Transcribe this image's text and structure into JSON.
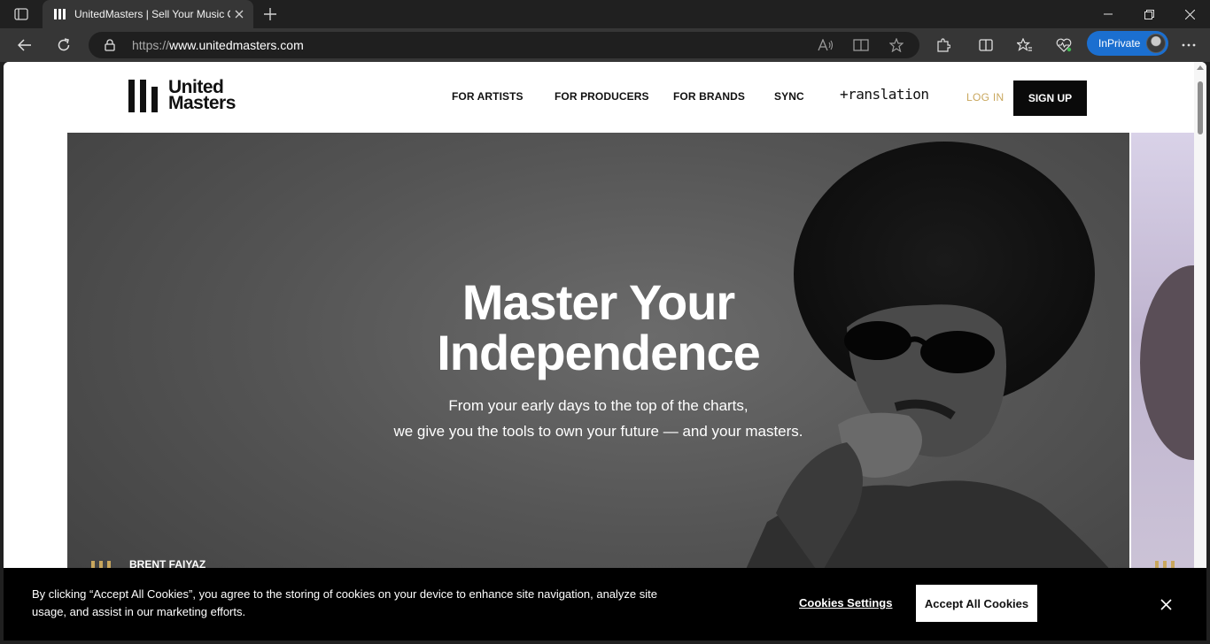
{
  "browser": {
    "tab": {
      "title": "UnitedMasters | Sell Your Music Online"
    },
    "address": {
      "protocol": "https://",
      "host": "www.unitedmasters.com"
    },
    "inprivate_label": "InPrivate"
  },
  "site": {
    "logo": {
      "line1": "United",
      "line2": "Masters"
    },
    "nav": [
      {
        "label": "FOR ARTISTS"
      },
      {
        "label": "FOR PRODUCERS"
      },
      {
        "label": "FOR BRANDS"
      },
      {
        "label": "SYNC"
      }
    ],
    "nav_translation": "+ranslation",
    "login_label": "LOG IN",
    "signup_label": "SIGN UP"
  },
  "hero": {
    "title_line1": "Master Your",
    "title_line2": "Independence",
    "subtitle_line1": "From your early days to the top of the charts,",
    "subtitle_line2": "we give you the tools to own your future — and your masters.",
    "caption": "BRENT FAIYAZ"
  },
  "cookie": {
    "text": "By clicking “Accept All Cookies”, you agree to the storing of cookies on your device to enhance site navigation, analyze site usage, and assist in our marketing efforts.",
    "settings_label": "Cookies Settings",
    "accept_label": "Accept All Cookies"
  },
  "colors": {
    "accent_gold": "#c9a75d",
    "inprivate_blue": "#1b6fd0",
    "chrome_dark": "#202020"
  }
}
